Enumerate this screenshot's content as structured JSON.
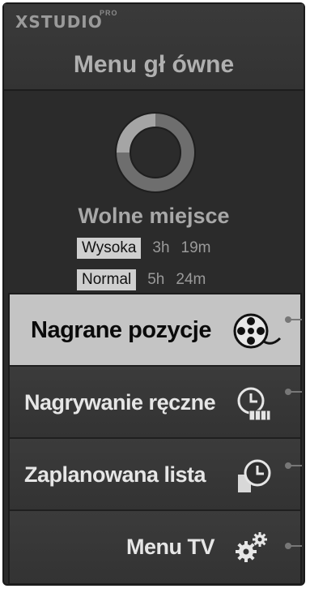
{
  "brand": {
    "logo": "XSTUDIO",
    "badge": "PRO"
  },
  "title": "Menu gł  ówne",
  "free_space": {
    "label": "Wolne miejsce",
    "rows": [
      {
        "quality": "Wysoka",
        "hours": "3h",
        "minutes": "19m"
      },
      {
        "quality": "Normal",
        "hours": "5h",
        "minutes": "24m"
      }
    ]
  },
  "menu": [
    {
      "label": "Nagrane pozycje",
      "icon": "film-reel-icon",
      "selected": true
    },
    {
      "label": "Nagrywanie ręczne",
      "icon": "clock-record-icon",
      "selected": false
    },
    {
      "label": "Zaplanowana lista",
      "icon": "clock-list-icon",
      "selected": false
    },
    {
      "label": "Menu TV",
      "icon": "gears-icon",
      "selected": false
    }
  ],
  "colors": {
    "panel": "#2b2b2b",
    "selected": "#c4c4c4",
    "text": "#e6e6e6",
    "muted": "#9a9a9a"
  }
}
